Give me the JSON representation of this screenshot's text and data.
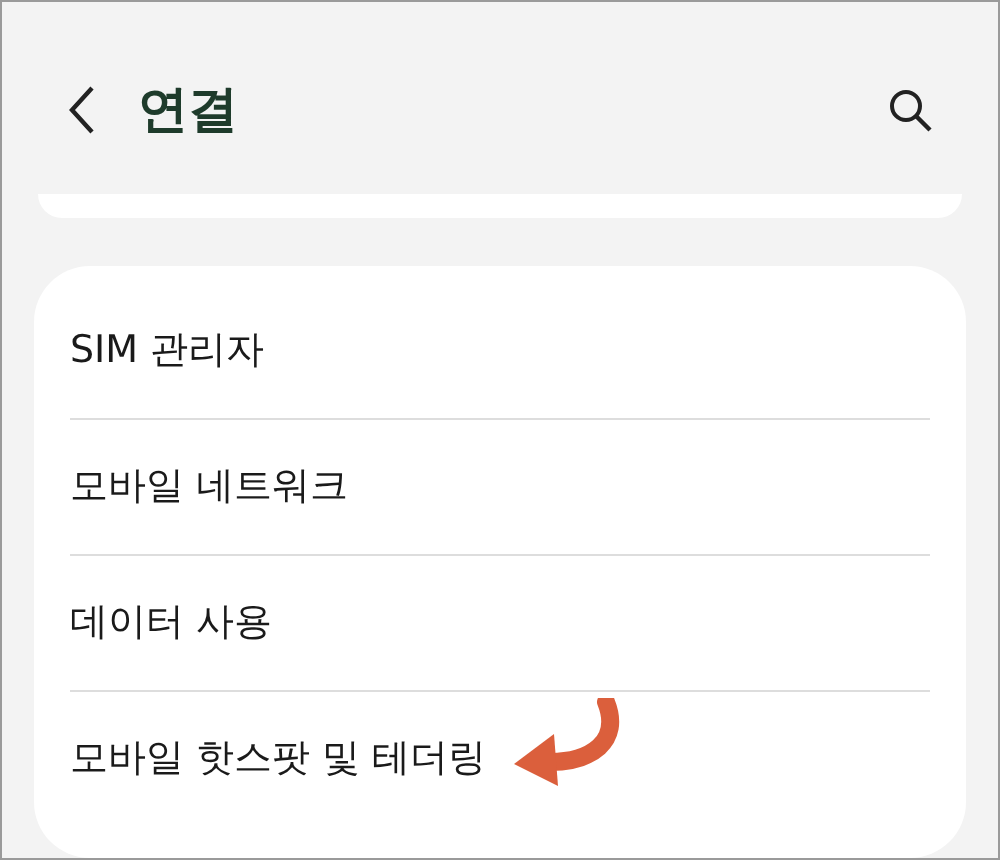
{
  "header": {
    "title": "연결"
  },
  "items": [
    {
      "label": "SIM 관리자",
      "highlighted": false
    },
    {
      "label": "모바일 네트워크",
      "highlighted": false
    },
    {
      "label": "데이터 사용",
      "highlighted": false
    },
    {
      "label": "모바일 핫스팟 및 테더링",
      "highlighted": true
    }
  ]
}
